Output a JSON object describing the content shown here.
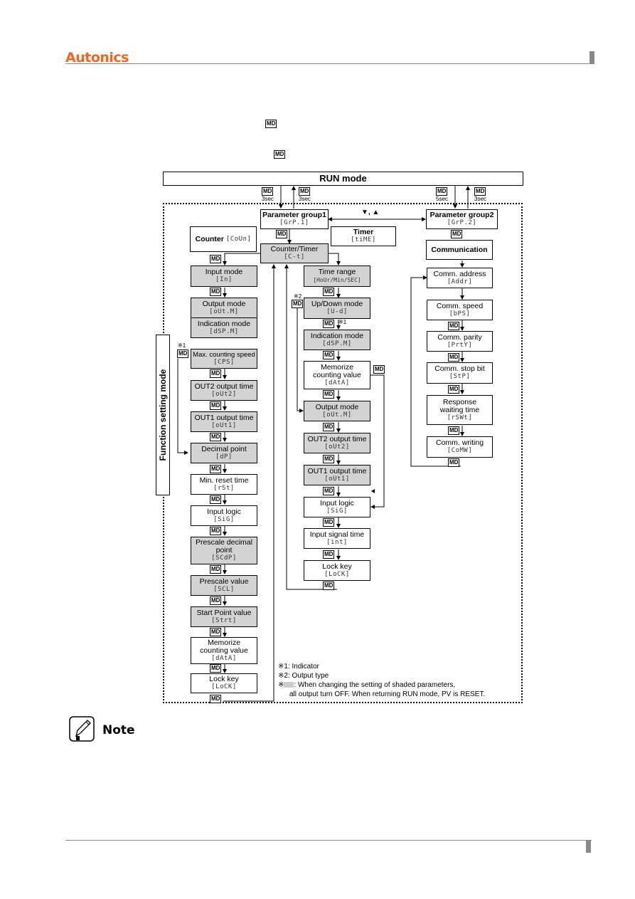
{
  "header": {
    "brand": "Autonics",
    "brand_color": "#f26522"
  },
  "intro": {
    "md_key_1": "MD",
    "md_key_2": "MD"
  },
  "diagram": {
    "run_mode": "RUN mode",
    "function_setting_mode": "Function setting mode",
    "md": "MD",
    "timings": [
      "3sec",
      "3sec",
      "5sec",
      "3sec"
    ],
    "switch_keys": "▼, ▲",
    "param_group1": {
      "title": "Parameter group1",
      "code": "[GrP.1]"
    },
    "param_group2": {
      "title": "Parameter group2",
      "code": "[GrP.2]"
    },
    "counter": {
      "title": "Counter",
      "code": "[CoUn]"
    },
    "timer": {
      "title": "Timer",
      "code": "[tiME]"
    },
    "counter_timer": {
      "title": "Counter/Timer",
      "code": "[C-t]"
    },
    "communication": {
      "title": "Communication"
    },
    "counter_column": [
      {
        "title": "Input mode",
        "code": "[In]",
        "shaded": true
      },
      {
        "title": "Output mode",
        "code": "[oUt.M]",
        "shaded": true
      },
      {
        "title": "Indication mode",
        "code": "[dSP.M]",
        "shaded": true
      },
      {
        "title": "Max. counting speed",
        "code": "[CPS]",
        "shaded": true
      },
      {
        "title": "OUT2 output time",
        "code": "[oUt2]",
        "shaded": true
      },
      {
        "title": "OUT1 output time",
        "code": "[oUt1]",
        "shaded": true
      },
      {
        "title": "Decimal point",
        "code": "[dP]",
        "shaded": true
      },
      {
        "title": "Min. reset time",
        "code": "[rSt]",
        "shaded": false
      },
      {
        "title": "Input logic",
        "code": "[SiG]",
        "shaded": false
      },
      {
        "title": "Prescale decimal point",
        "code": "[SCdP]",
        "shaded": true
      },
      {
        "title": "Prescale value",
        "code": "[SCL]",
        "shaded": true
      },
      {
        "title": "Start Point value",
        "code": "[Strt]",
        "shaded": true
      },
      {
        "title": "Memorize counting value",
        "code": "[dAtA]",
        "shaded": false
      },
      {
        "title": "Lock key",
        "code": "[LoCK]",
        "shaded": false
      }
    ],
    "timer_column": [
      {
        "title": "Time range",
        "code": "[HoUr/Min/SEC]",
        "shaded": true
      },
      {
        "title": "Up/Down mode",
        "code": "[U-d]",
        "shaded": true
      },
      {
        "title": "Indication mode",
        "code": "[dSP.M]",
        "shaded": true
      },
      {
        "title": "Memorize counting value",
        "code": "[dAtA]",
        "shaded": false
      },
      {
        "title": "Output mode",
        "code": "[oUt.M]",
        "shaded": true
      },
      {
        "title": "OUT2 output time",
        "code": "[oUt2]",
        "shaded": true
      },
      {
        "title": "OUT1 output time",
        "code": "[oUt1]",
        "shaded": true
      },
      {
        "title": "Input logic",
        "code": "[SiG]",
        "shaded": false
      },
      {
        "title": "Input signal time",
        "code": "[int]",
        "shaded": false
      },
      {
        "title": "Lock key",
        "code": "[LoCK]",
        "shaded": false
      }
    ],
    "comm_column": [
      {
        "title": "Comm. address",
        "code": "[Addr]"
      },
      {
        "title": "Comm. speed",
        "code": "[bPS]"
      },
      {
        "title": "Comm. parity",
        "code": "[PrtY]"
      },
      {
        "title": "Comm. stop bit",
        "code": "[StP]"
      },
      {
        "title": "Response waiting time",
        "code": "[rSWt]"
      },
      {
        "title": "Comm. writing",
        "code": "[CoMW]"
      }
    ],
    "marks": {
      "n1": "※1",
      "n2": "※2"
    },
    "legend": {
      "line1": "※1: Indicator",
      "line2": "※2: Output type",
      "line3_prefix": "※",
      "line3": ": When changing the setting of shaded parameters,",
      "line4": "all output turn OFF. When returning RUN mode, PV is RESET."
    }
  },
  "note": {
    "label": "Note"
  }
}
